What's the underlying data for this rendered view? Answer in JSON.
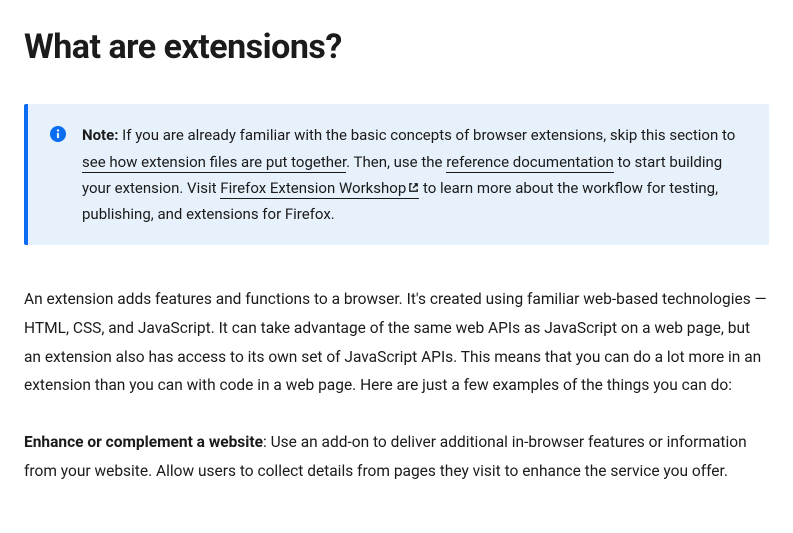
{
  "heading": "What are extensions?",
  "note": {
    "label": "Note:",
    "text_before_link1": " If you are already familiar with the basic concepts of browser extensions, skip this section to ",
    "link1": "see how extension files are put together",
    "text_after_link1": ". Then, use the ",
    "link2": "reference documentation",
    "text_after_link2": " to start building your extension. Visit ",
    "link3": "Firefox Extension Workshop",
    "text_after_link3": " to learn more about the workflow for testing, publishing, and extensions for Firefox."
  },
  "para1": "An extension adds features and functions to a browser. It's created using familiar web-based technologies — HTML, CSS, and JavaScript. It can take advantage of the same web APIs as JavaScript on a web page, but an extension also has access to its own set of JavaScript APIs. This means that you can do a lot more in an extension than you can with code in a web page. Here are just a few examples of the things you can do:",
  "para2_strong": "Enhance or complement a website",
  "para2_rest": ": Use an add-on to deliver additional in-browser features or information from your website. Allow users to collect details from pages they visit to enhance the service you offer."
}
